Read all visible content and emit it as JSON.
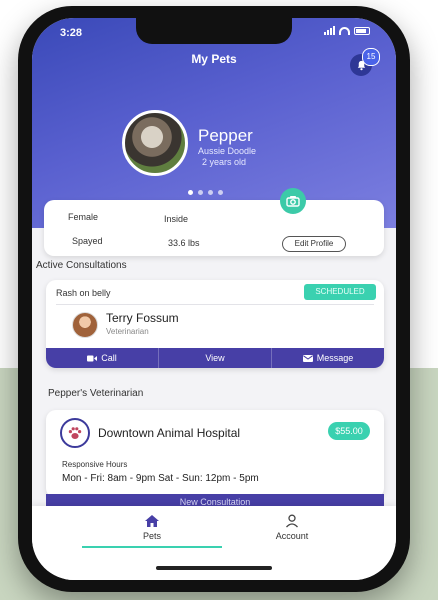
{
  "status_bar": {
    "time": "3:28"
  },
  "header": {
    "title": "My Pets",
    "notifications_count": "15"
  },
  "pet": {
    "name": "Pepper",
    "breed": "Aussie Doodle",
    "age": "2 years old"
  },
  "pet_info": {
    "sex": "Female",
    "living": "Inside",
    "neutered": "Spayed",
    "weight": "33.6 lbs",
    "edit_label": "Edit Profile"
  },
  "consultations": {
    "section_title": "Active Consultations",
    "topic": "Rash on belly",
    "status": "SCHEDULED",
    "vet_name": "Terry Fossum",
    "vet_role": "Veterinarian",
    "actions": {
      "call": "Call",
      "view": "View",
      "message": "Message"
    }
  },
  "veterinarian": {
    "section_title": "Pepper's Veterinarian",
    "hospital": "Downtown Animal Hospital",
    "price": "$55.00",
    "hours_label": "Responsive Hours",
    "hours": "Mon - Fri: 8am - 9pm Sat - Sun: 12pm - 5pm",
    "new_consult_label": "New Consultation"
  },
  "tabs": {
    "pets": "Pets",
    "account": "Account"
  },
  "colors": {
    "primary": "#473fa6",
    "accent": "#3ad1b0",
    "hero_start": "#3a49b8",
    "hero_end": "#7c7fe0",
    "backdrop": "#c9d6c0"
  }
}
